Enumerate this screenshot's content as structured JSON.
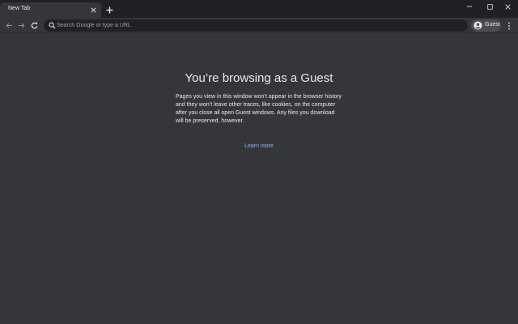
{
  "tabs": [
    {
      "title": "New Tab",
      "active": true
    }
  ],
  "toolbar": {
    "omnibox_placeholder": "Search Google or type a URL",
    "profile_label": "Guest"
  },
  "page": {
    "heading": "You’re browsing as a Guest",
    "description": "Pages you view in this window won’t appear in the browser history and they won’t leave other traces, like cookies, on the computer after you close all open Guest windows. Any files you download will be preserved, however.",
    "learn_more": "Learn more"
  },
  "icons": {
    "tab_close": "close-icon",
    "new_tab": "plus-icon",
    "minimize": "minimize-icon",
    "maximize": "maximize-icon",
    "close_window": "close-icon",
    "back": "arrow-left-icon",
    "forward": "arrow-right-icon",
    "reload": "reload-icon",
    "search": "search-icon",
    "avatar": "account-circle-icon",
    "menu": "kebab-menu-icon"
  },
  "colors": {
    "frame": "#202124",
    "toolbar": "#35363a",
    "omnibox": "#202124",
    "text": "#e8eaed",
    "link": "#8ab4f8"
  }
}
